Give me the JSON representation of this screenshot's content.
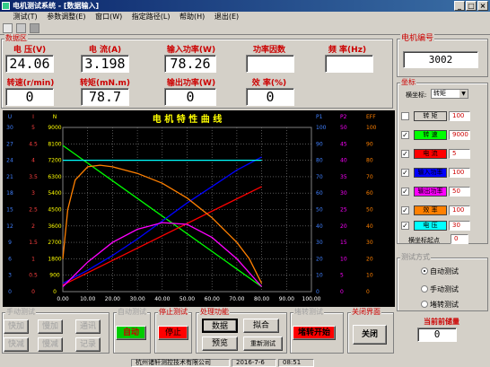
{
  "window": {
    "title": "电机测试系统 - [数据输入]",
    "min": "_",
    "max": "□",
    "close": "×"
  },
  "menu": [
    "测试(T)",
    "参数调整(E)",
    "窗口(W)",
    "指定路径(L)",
    "帮助(H)",
    "退出(E)"
  ],
  "data_panel": {
    "title": "数据区",
    "row1": [
      {
        "label": "电 压(V)",
        "value": "24.06"
      },
      {
        "label": "电 流(A)",
        "value": "3.198"
      },
      {
        "label": "输入功率(W)",
        "value": "78.26"
      },
      {
        "label": "功率因数",
        "value": ""
      },
      {
        "label": "频 率(Hz)",
        "value": ""
      }
    ],
    "row2": [
      {
        "label": "转速(r/min)",
        "value": "0"
      },
      {
        "label": "转矩(mN.m)",
        "value": "78.7"
      },
      {
        "label": "输出功率(W)",
        "value": "0"
      },
      {
        "label": "效 率(%)",
        "value": "0"
      }
    ]
  },
  "motor_no": {
    "title": "电机编号",
    "value": "3002"
  },
  "axis_panel": {
    "title": "坐标",
    "x_axis_label": "横坐标:",
    "x_axis_value": "转矩",
    "items": [
      {
        "name": "转 矩",
        "checked": "",
        "value": "100",
        "color": "#d4d0c8"
      },
      {
        "name": "转 速",
        "checked": "✓",
        "value": "9000",
        "color": "#00ff00"
      },
      {
        "name": "电 流",
        "checked": "✓",
        "value": "5",
        "color": "#ff0000"
      },
      {
        "name": "输入功率",
        "checked": "✓",
        "value": "100",
        "color": "#0000ff"
      },
      {
        "name": "输出功率",
        "checked": "✓",
        "value": "50",
        "color": "#ff00ff"
      },
      {
        "name": "效 率",
        "checked": "✓",
        "value": "100",
        "color": "#ff8000"
      },
      {
        "name": "电 压",
        "checked": "✓",
        "value": "30",
        "color": "#00ffff"
      }
    ],
    "origin_label": "横坐标起点",
    "origin_value": "0"
  },
  "test_mode": {
    "title": "测试方式",
    "options": [
      "自动测试",
      "手动测试",
      "堵转测试"
    ]
  },
  "saved": {
    "title": "当前前储量",
    "value": "0"
  },
  "manual": {
    "title": "手动测试",
    "buttons": [
      "快加",
      "慢加",
      "通讯",
      "快减",
      "慢减",
      "记录"
    ]
  },
  "auto": {
    "title": "自动测试",
    "button": "自动"
  },
  "stop": {
    "title": "停止测试",
    "button": "停止"
  },
  "process": {
    "title": "处理功能",
    "buttons": [
      "数据",
      "拟合",
      "预览",
      "重新测试"
    ]
  },
  "lock": {
    "title": "堵转测试",
    "button": "堵转开始"
  },
  "close": {
    "title": "关闭界面",
    "button": "关闭"
  },
  "status": {
    "company": "杭州诸轩测控技术有限公司",
    "date": "2016-7-6",
    "time": "08:51"
  },
  "colors": {
    "speed": "#00ff00",
    "current": "#ff0000",
    "pin": "#0000ff",
    "pout": "#ff00ff",
    "eff": "#ff8000",
    "volt": "#00ffff"
  },
  "chart_data": {
    "type": "line",
    "title": "电 机 特 性 曲 线",
    "x_ticks": [
      "0.00",
      "10.00",
      "20.00",
      "30.00",
      "40.00",
      "50.00",
      "60.00",
      "70.00",
      "80.00",
      "90.00",
      "100.00"
    ],
    "xlim": [
      0,
      100
    ],
    "left_axes": [
      {
        "name": "U",
        "ticks": [
          "30",
          "27",
          "24",
          "21",
          "18",
          "15",
          "12",
          "9",
          "6",
          "3",
          "0"
        ]
      },
      {
        "name": "I",
        "ticks": [
          "5",
          "4.5",
          "4",
          "3.5",
          "3",
          "2.5",
          "2",
          "1.5",
          "1",
          "0.5",
          "0"
        ]
      },
      {
        "name": "N",
        "ticks": [
          "9000",
          "8100",
          "7200",
          "6300",
          "5400",
          "4500",
          "3600",
          "2700",
          "1800",
          "900",
          "0"
        ]
      }
    ],
    "right_axes": [
      {
        "name": "P1",
        "ticks": [
          "100",
          "90",
          "80",
          "70",
          "60",
          "50",
          "40",
          "30",
          "20",
          "10",
          "0"
        ]
      },
      {
        "name": "P2",
        "ticks": [
          "50",
          "45",
          "40",
          "35",
          "30",
          "25",
          "20",
          "15",
          "10",
          "5",
          "0"
        ]
      },
      {
        "name": "EFF",
        "ticks": [
          "100",
          "90",
          "80",
          "70",
          "60",
          "50",
          "40",
          "30",
          "20",
          "10",
          "0"
        ]
      }
    ],
    "series": [
      {
        "name": "转速",
        "color": "#00ff00",
        "x": [
          0,
          80
        ],
        "y": [
          0.89,
          0.03
        ]
      },
      {
        "name": "电流",
        "color": "#ff0000",
        "x": [
          0,
          80
        ],
        "y": [
          0.04,
          0.64
        ]
      },
      {
        "name": "输入功率",
        "color": "#0000ff",
        "x": [
          0,
          10,
          20,
          30,
          40,
          50,
          60,
          70,
          80
        ],
        "y": [
          0.05,
          0.13,
          0.22,
          0.32,
          0.43,
          0.54,
          0.64,
          0.74,
          0.82
        ]
      },
      {
        "name": "电压",
        "color": "#00ffff",
        "x": [
          0,
          80
        ],
        "y": [
          0.8,
          0.8
        ]
      },
      {
        "name": "效率",
        "color": "#ff8000",
        "x": [
          0,
          2,
          5,
          10,
          15,
          20,
          30,
          40,
          50,
          60,
          70,
          75,
          80
        ],
        "y": [
          0.2,
          0.5,
          0.68,
          0.76,
          0.77,
          0.76,
          0.72,
          0.66,
          0.57,
          0.45,
          0.3,
          0.2,
          0.05
        ]
      },
      {
        "name": "输出功率",
        "color": "#ff00ff",
        "x": [
          0,
          10,
          20,
          30,
          40,
          50,
          60,
          70,
          80
        ],
        "y": [
          0.03,
          0.18,
          0.3,
          0.38,
          0.42,
          0.41,
          0.33,
          0.2,
          0.03
        ]
      }
    ]
  }
}
